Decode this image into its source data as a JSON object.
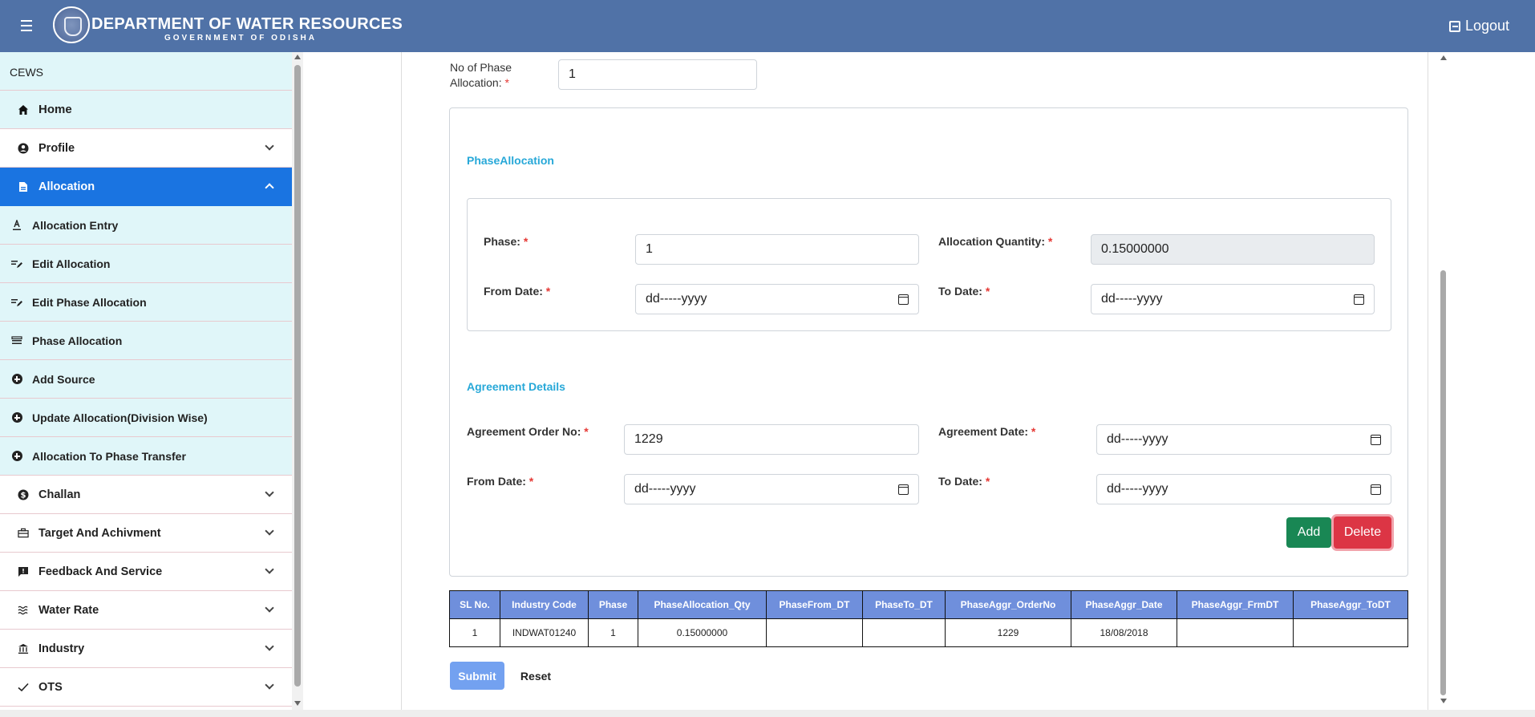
{
  "header": {
    "title": "DEPARTMENT OF WATER RESOURCES",
    "subtitle": "GOVERNMENT OF ODISHA",
    "logout_label": "Logout"
  },
  "sidebar": {
    "title": "CEWS",
    "items": [
      {
        "label": "Home",
        "icon": "home-icon"
      },
      {
        "label": "Profile",
        "icon": "user-circle-icon"
      },
      {
        "label": "Allocation",
        "icon": "document-icon"
      },
      {
        "label": "Allocation Entry",
        "icon": "text-underline-icon"
      },
      {
        "label": "Edit Allocation",
        "icon": "edit-list-icon"
      },
      {
        "label": "Edit Phase Allocation",
        "icon": "edit-list-icon"
      },
      {
        "label": "Phase Allocation",
        "icon": "stack-icon"
      },
      {
        "label": "Add Source",
        "icon": "plus-circle-icon"
      },
      {
        "label": "Update Allocation(Division Wise)",
        "icon": "plus-circle-icon"
      },
      {
        "label": "Allocation To Phase Transfer",
        "icon": "plus-circle-icon"
      },
      {
        "label": "Challan",
        "icon": "dollar-circle-icon"
      },
      {
        "label": "Target And Achivment",
        "icon": "briefcase-icon"
      },
      {
        "label": "Feedback And Service",
        "icon": "feedback-icon"
      },
      {
        "label": "Water Rate",
        "icon": "waves-icon"
      },
      {
        "label": "Industry",
        "icon": "bank-icon"
      },
      {
        "label": "OTS",
        "icon": "check-icon"
      }
    ]
  },
  "form": {
    "no_of_phase_label_1": "No of Phase",
    "no_of_phase_label_2": "Allocation:",
    "no_of_phase_value": "1",
    "phase_section_title": "PhaseAllocation",
    "phase_label": "Phase:",
    "phase_value": "1",
    "allocation_qty_label": "Allocation Quantity:",
    "allocation_qty_value": "0.15000000",
    "from_date_label": "From Date:",
    "to_date_label": "To Date:",
    "date_placeholder": "dd-----yyyy",
    "agreement_section_title": "Agreement Details",
    "agreement_order_label": "Agreement Order No:",
    "agreement_order_value": "1229",
    "agreement_date_label": "Agreement Date:",
    "required_marker": "*"
  },
  "buttons": {
    "add": "Add",
    "delete": "Delete",
    "submit": "Submit",
    "reset": "Reset"
  },
  "table": {
    "headers": [
      "SL No.",
      "Industry Code",
      "Phase",
      "PhaseAllocation_Qty",
      "PhaseFrom_DT",
      "PhaseTo_DT",
      "PhaseAggr_OrderNo",
      "PhaseAggr_Date",
      "PhaseAggr_FrmDT",
      "PhaseAggr_ToDT"
    ],
    "rows": [
      [
        "1",
        "INDWAT01240",
        "1",
        "0.15000000",
        "",
        "",
        "1229",
        "18/08/2018",
        "",
        ""
      ]
    ]
  },
  "colors": {
    "header_bg": "#5072a7",
    "active_item": "#1a74e1",
    "section_title": "#27a8d8",
    "table_header": "#6f8fdc"
  }
}
